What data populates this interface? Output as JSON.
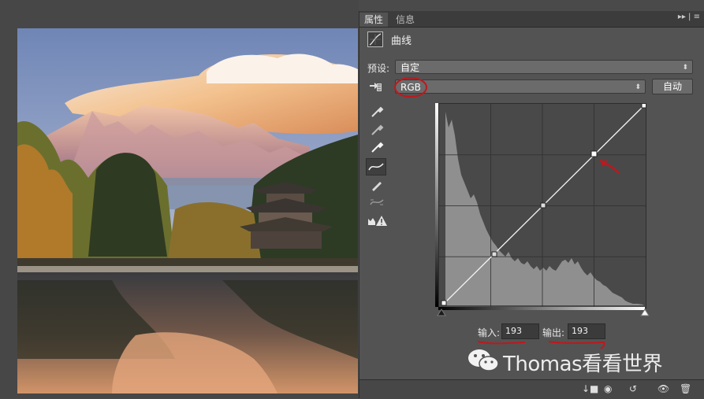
{
  "panel": {
    "tabs": [
      "属性",
      "信息"
    ],
    "title": "曲线",
    "preset_label": "预设:",
    "preset_value": "自定",
    "channel_value": "RGB",
    "auto_button": "自动",
    "input_label": "输入:",
    "input_value": "193",
    "output_label": "输出:",
    "output_value": "193"
  },
  "watermark": {
    "text": "Thomas看看世界"
  },
  "colors": {
    "panel": "#535353",
    "accent_annotation": "#c0171c"
  }
}
